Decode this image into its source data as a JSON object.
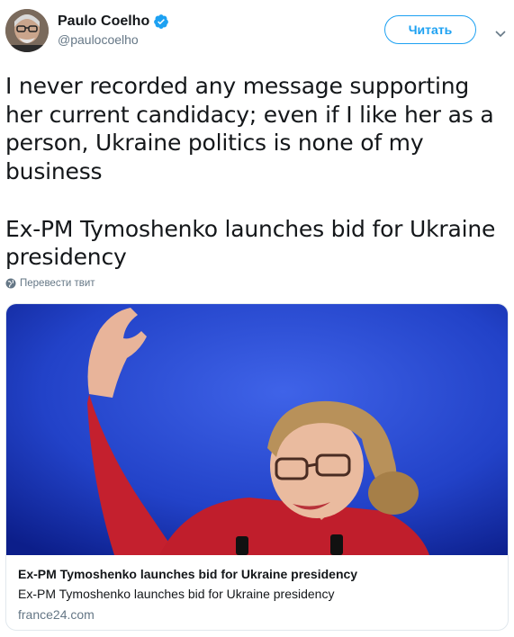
{
  "author": {
    "name": "Paulo Coelho",
    "handle": "@paulocoelho",
    "verified_icon": "verified-badge-icon",
    "avatar_icon": "avatar-photo"
  },
  "actions": {
    "follow_label": "Читать",
    "more_icon": "chevron-down-icon"
  },
  "tweet": {
    "text": "I never recorded any message supporting her current  candidacy; even if I like her as a person, Ukraine politics is none of my business\n\nEx-PM Tymoshenko launches bid for Ukraine presidency",
    "translate_label": "Перевести твит",
    "translate_icon": "globe-icon"
  },
  "card": {
    "title": "Ex-PM Tymoshenko launches bid for Ukraine presidency",
    "description": "Ex-PM Tymoshenko launches bid for Ukraine presidency",
    "domain": "france24.com",
    "image_icon": "article-photo"
  },
  "colors": {
    "accent": "#1da1f2",
    "secondary_text": "#657786",
    "primary_text": "#14171a",
    "border": "#e1e8ed"
  }
}
